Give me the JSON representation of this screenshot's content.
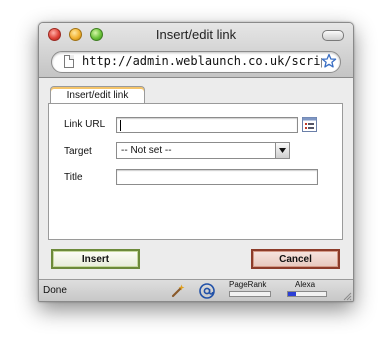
{
  "window": {
    "title": "Insert/edit link"
  },
  "address_bar": {
    "url": "http://admin.weblaunch.co.uk/script"
  },
  "tabs": [
    {
      "label": "Insert/edit link"
    }
  ],
  "form": {
    "link_url": {
      "label": "Link URL",
      "value": ""
    },
    "target": {
      "label": "Target",
      "selected": "-- Not set --"
    },
    "title": {
      "label": "Title",
      "value": ""
    }
  },
  "buttons": {
    "insert_label": "Insert",
    "cancel_label": "Cancel"
  },
  "status_bar": {
    "status_text": "Done",
    "pagerank_label": "PageRank",
    "alexa_label": "Alexa",
    "pagerank_level": 0,
    "alexa_level": 0.2
  },
  "colors": {
    "insert_border": "#6d8a3a",
    "cancel_border": "#8c3c2a",
    "alexa_fill": "#2b3fd6"
  },
  "icons": {
    "page": "document-icon",
    "bookmark": "star-icon",
    "picker": "browse-list-icon",
    "tool": "wand-icon",
    "at": "at-sign-icon"
  }
}
